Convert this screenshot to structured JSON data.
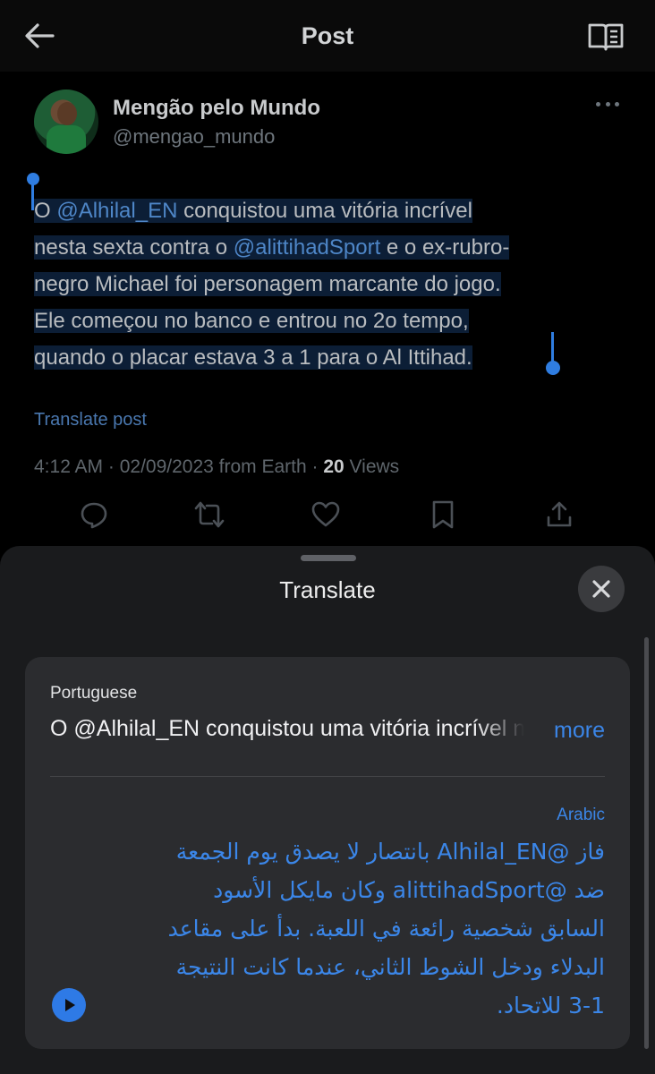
{
  "header": {
    "title": "Post",
    "back_icon": "arrow-left-icon",
    "reader_icon": "book-open-icon"
  },
  "post": {
    "author_name": "Mengão pelo Mundo",
    "author_handle": "@mengao_mundo",
    "text_lines": [
      [
        "O ",
        "@Alhilal_EN",
        " conquistou uma vitória incrível"
      ],
      [
        "nesta sexta contra o ",
        "@alittihadSport",
        " e o ex-rubro-"
      ],
      [
        "negro Michael foi personagem marcante do jogo."
      ],
      [
        "Ele começou no banco e entrou no 2o tempo,"
      ],
      [
        "quando o placar estava 3 a 1 para o Al Ittihad."
      ]
    ],
    "translate_link": "Translate post",
    "timestamp": "4:12 AM · 02/09/2023 from Earth · ",
    "views_count": "20",
    "views_label": " Views",
    "actions": [
      "reply-icon",
      "repost-icon",
      "like-icon",
      "bookmark-icon",
      "share-icon"
    ]
  },
  "translate_sheet": {
    "title": "Translate",
    "close_icon": "close-icon",
    "source_language": "Portuguese",
    "source_text": "O @Alhilal_EN conquistou uma vitória incrível nesta sexta contra o @alittihadSport",
    "more_label": "more",
    "target_language": "Arabic",
    "target_lines": [
      "فاز @Alhilal_EN بانتصار لا يصدق يوم الجمعة",
      "ضد @alittihadSport وكان مايكل الأسود",
      "السابق شخصية رائعة في اللعبة. بدأ على مقاعد",
      "البدلاء ودخل الشوط الثاني، عندما كانت النتيجة",
      "3-1 للاتحاد."
    ],
    "play_icon": "play-icon"
  },
  "colors": {
    "accent_blue": "#3b86e8",
    "selection_blue": "#2f7de1",
    "background": "#000000",
    "sheet_background": "#1a1b1d"
  }
}
